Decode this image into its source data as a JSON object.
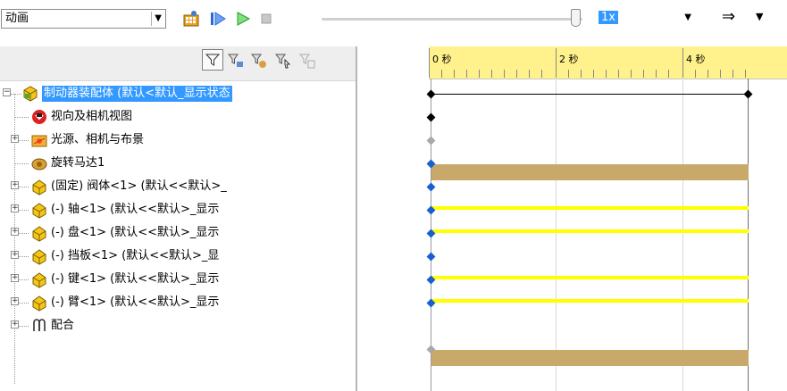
{
  "toolbar": {
    "mode_select": "动画",
    "speed_value": "1x",
    "icons": [
      "calculate-icon",
      "play-from-start-icon",
      "play-icon",
      "stop-icon",
      "playback-arrow-icon"
    ]
  },
  "left_header": {
    "icons": [
      "filter-icon",
      "filter-animating-icon",
      "filter-driving-icon",
      "filter-selected-icon",
      "filter-results-icon"
    ]
  },
  "tree": {
    "items": [
      {
        "label": "制动器装配体 (默认<默认_显示状态",
        "icon": "assembly-icon",
        "selected": true
      },
      {
        "label": "视向及相机视图",
        "icon": "camera-view-icon"
      },
      {
        "label": "光源、相机与布景",
        "icon": "lights-folder-icon"
      },
      {
        "label": "旋转马达1",
        "icon": "rotary-motor-icon"
      },
      {
        "label": "(固定) 阀体<1> (默认<<默认>_",
        "icon": "part-icon"
      },
      {
        "label": "(-) 轴<1> (默认<<默认>_显示",
        "icon": "part-icon"
      },
      {
        "label": "(-) 盘<1> (默认<<默认>_显示",
        "icon": "part-icon"
      },
      {
        "label": "(-) 挡板<1> (默认<<默认>_显",
        "icon": "part-icon"
      },
      {
        "label": "(-) 键<1> (默认<<默认>_显示",
        "icon": "part-icon"
      },
      {
        "label": "(-) 臂<1> (默认<<默认>_显示",
        "icon": "part-icon"
      },
      {
        "label": "配合",
        "icon": "mates-icon"
      }
    ]
  },
  "timeline": {
    "ticks": [
      "0 秒",
      "2 秒",
      "4 秒"
    ],
    "bar_colors": {
      "gold": "#c8a96a",
      "yellow": "#ffff00"
    }
  }
}
